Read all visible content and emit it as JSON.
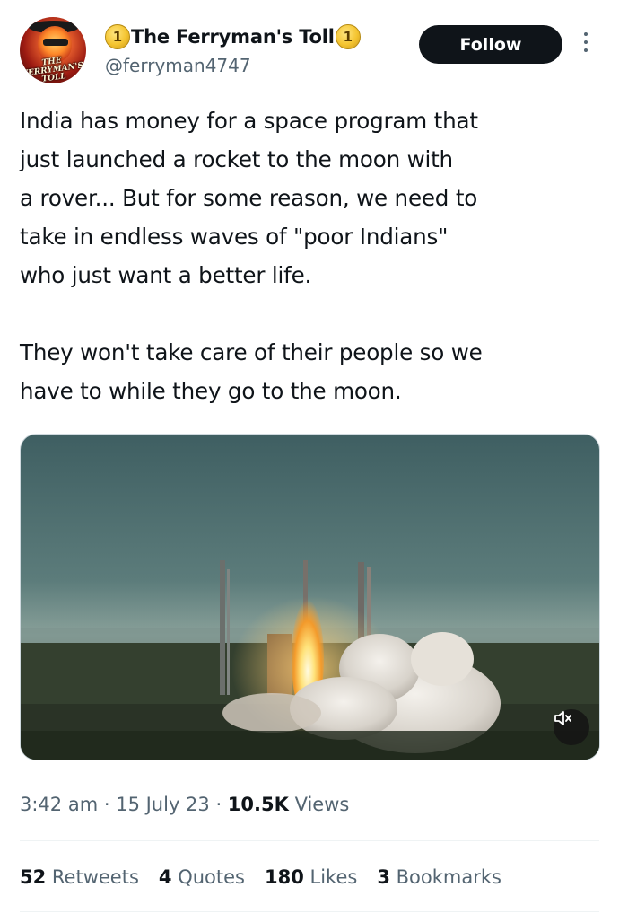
{
  "author": {
    "display_name": "The Ferryman's Toll",
    "handle": "@ferryman4747",
    "badge_number": "1",
    "avatar_text": "THE\nFERRYMAN'S\nTOLL"
  },
  "header": {
    "follow_label": "Follow",
    "more_icon": "more-vertical-icon"
  },
  "tweet": {
    "paragraphs": [
      "India has money for a space program that\njust launched a rocket to the moon with\na rover... But for some reason, we need to\ntake in endless waves of \"poor Indians\"\nwho just want a better life.",
      "They won't take care of their people so we\nhave to while they go to the moon."
    ]
  },
  "media": {
    "mute_icon": "volume-mute-icon"
  },
  "meta": {
    "time": "3:42 am",
    "sep1": " · ",
    "date": "15 July 23",
    "sep2": " · ",
    "views_count": "10.5K",
    "views_label": " Views"
  },
  "stats": {
    "retweets_count": "52",
    "retweets_label": " Retweets",
    "quotes_count": "4",
    "quotes_label": " Quotes",
    "likes_count": "180",
    "likes_label": " Likes",
    "bookmarks_count": "3",
    "bookmarks_label": " Bookmarks"
  }
}
